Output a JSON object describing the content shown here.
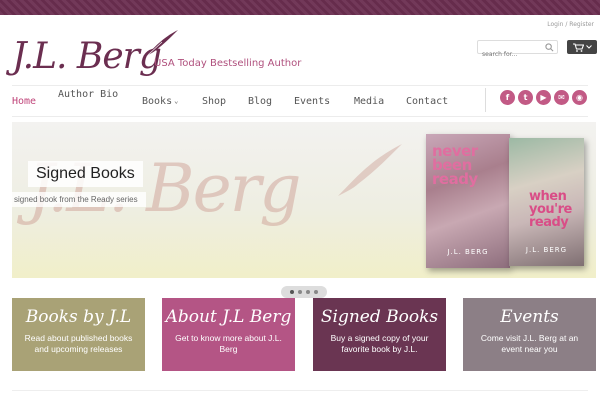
{
  "utility": {
    "login": "Login",
    "separator": "/",
    "register": "Register"
  },
  "logo": {
    "name": "J.L. Berg",
    "tagline": "USA Today Bestselling Author"
  },
  "search": {
    "placeholder": "search for..."
  },
  "nav": {
    "items": [
      {
        "label": "Home",
        "active": true
      },
      {
        "label": "Author Bio"
      },
      {
        "label": "Books",
        "has_dropdown": true
      },
      {
        "label": "Shop"
      },
      {
        "label": "Blog"
      },
      {
        "label": "Events"
      },
      {
        "label": "Media"
      },
      {
        "label": "Contact"
      }
    ]
  },
  "social": [
    {
      "icon": "facebook-icon",
      "glyph": "f"
    },
    {
      "icon": "twitter-icon",
      "glyph": "t"
    },
    {
      "icon": "youtube-icon",
      "glyph": "▶"
    },
    {
      "icon": "email-icon",
      "glyph": "✉"
    },
    {
      "icon": "rss-icon",
      "glyph": "◉"
    }
  ],
  "hero": {
    "title": "Signed Books",
    "subtitle": "signed book from the Ready series",
    "watermark": "J.L. Berg",
    "books": [
      {
        "title": "never been ready",
        "author": "J.L. BERG"
      },
      {
        "title": "when you're ready",
        "author": "J.L. BERG"
      }
    ],
    "slides": 4,
    "active_slide": 1
  },
  "tiles": [
    {
      "title": "Books by J.L",
      "desc": "Read about published books and upcoming releases"
    },
    {
      "title": "About J.L Berg",
      "desc": "Get to know more about J.L. Berg"
    },
    {
      "title": "Signed Books",
      "desc": "Buy a signed copy of your favorite book by J.L."
    },
    {
      "title": "Events",
      "desc": "Come visit J.L. Berg at an event near you"
    }
  ],
  "colors": {
    "brand": "#6b2e50",
    "accent": "#c0457a",
    "social": "#c25a85"
  }
}
